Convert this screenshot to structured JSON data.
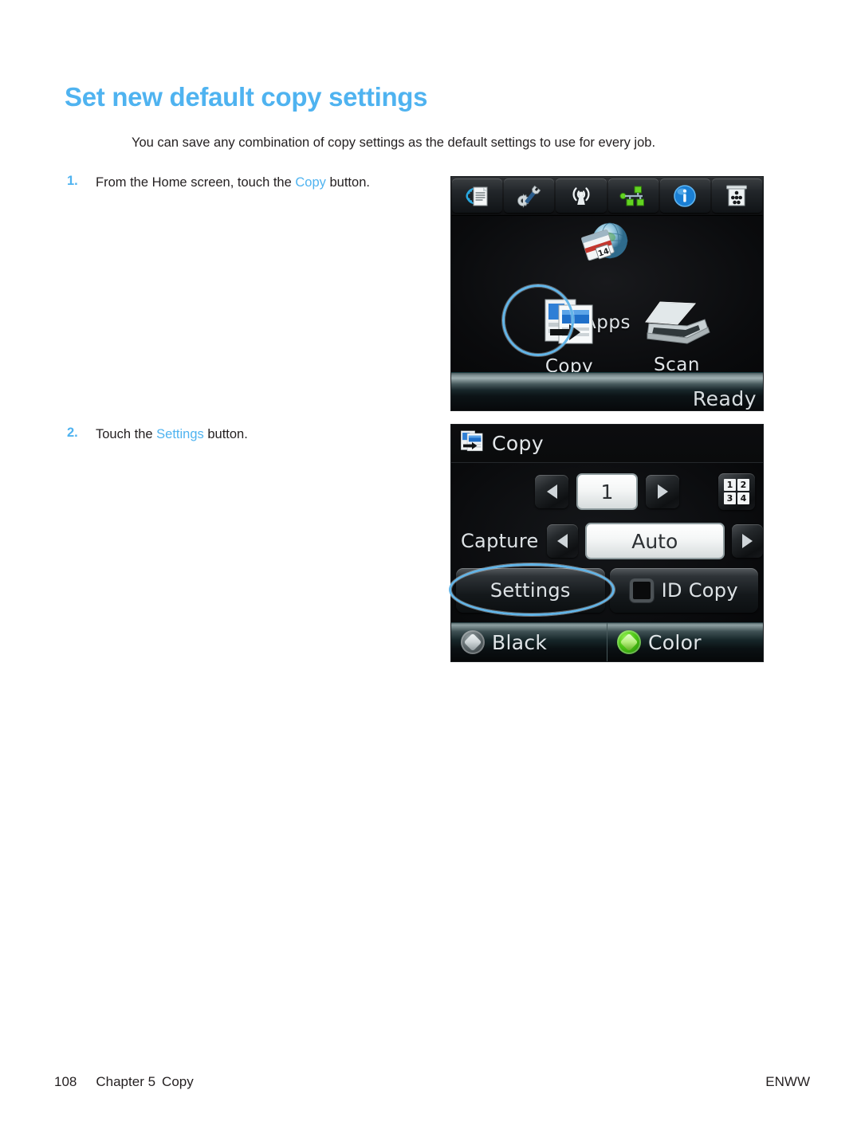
{
  "page": {
    "title": "Set new default copy settings",
    "intro": "You can save any combination of copy settings as the default settings to use for every job.",
    "title_color": "#4fb3f0"
  },
  "steps": [
    {
      "number": "1.",
      "text_before": "From the Home screen, touch the ",
      "highlight": "Copy",
      "text_after": " button."
    },
    {
      "number": "2.",
      "text_before": "Touch the ",
      "highlight": "Settings",
      "text_after": " button."
    }
  ],
  "home_screen": {
    "toolbar_icons": [
      "fax-icon",
      "setup-wrench-gear-icon",
      "wireless-icon",
      "network-icon",
      "information-icon",
      "supplies-icon"
    ],
    "apps_label": "Apps",
    "apps_icon": "globe-calendar-icon",
    "apps_calendar_day": "14",
    "tiles": [
      {
        "label": "Copy",
        "icon": "copy-icon",
        "highlighted": true
      },
      {
        "label": "Scan",
        "icon": "scanner-icon",
        "highlighted": false
      }
    ],
    "status": "Ready"
  },
  "copy_screen": {
    "header": {
      "icon": "copy-icon",
      "label": "Copy"
    },
    "copies": {
      "decrement_icon": "left-arrow-icon",
      "value": "1",
      "increment_icon": "right-arrow-icon",
      "collate_icon": "collate-icon",
      "collate_cells": [
        "1",
        "2",
        "3",
        "4"
      ]
    },
    "capture": {
      "label": "Capture",
      "decrement_icon": "left-arrow-icon",
      "value": "Auto",
      "increment_icon": "right-arrow-icon"
    },
    "actions": [
      {
        "label": "Settings",
        "highlighted": true
      },
      {
        "label": "ID Copy",
        "highlighted": false,
        "icon": "id-card-icon"
      }
    ],
    "footer_buttons": [
      {
        "label": "Black",
        "icon": "start-button-black-icon",
        "color": "#6a7578"
      },
      {
        "label": "Color",
        "icon": "start-button-color-icon",
        "color": "#4cc614"
      }
    ]
  },
  "footer": {
    "page_number": "108",
    "chapter": "Chapter 5",
    "chapter_title": "Copy",
    "locale": "ENWW"
  }
}
